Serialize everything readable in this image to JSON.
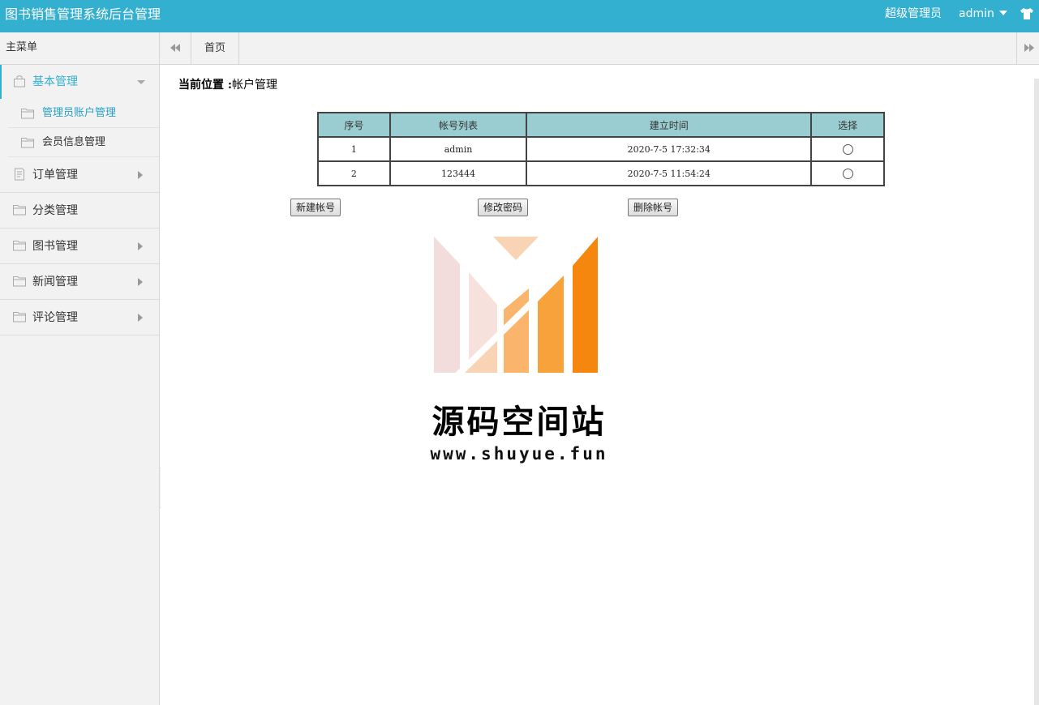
{
  "header": {
    "app_title": "图书销售管理系统后台管理",
    "role": "超级管理员",
    "username": "admin",
    "skin_icon": "tshirt-icon"
  },
  "sidebar": {
    "title": "主菜单",
    "groups": [
      {
        "label": "基本管理",
        "icon": "bag-icon",
        "expanded": true,
        "items": [
          {
            "label": "管理员账户管理",
            "icon": "folder-icon",
            "current": true
          },
          {
            "label": "会员信息管理",
            "icon": "folder-icon",
            "current": false
          }
        ]
      },
      {
        "label": "订单管理",
        "icon": "document-icon"
      },
      {
        "label": "分类管理",
        "icon": "folder-icon"
      },
      {
        "label": "图书管理",
        "icon": "folder-icon"
      },
      {
        "label": "新闻管理",
        "icon": "folder-icon"
      },
      {
        "label": "评论管理",
        "icon": "folder-icon"
      }
    ]
  },
  "tabs": {
    "home": "首页"
  },
  "main": {
    "location_label": "当前位置 :",
    "location_value": "帐户管理",
    "table": {
      "headers": [
        "序号",
        "帐号列表",
        "建立时间",
        "选择"
      ],
      "rows": [
        {
          "no": "1",
          "account": "admin",
          "created": "2020-7-5 17:32:34"
        },
        {
          "no": "2",
          "account": "123444",
          "created": "2020-7-5 11:54:24"
        }
      ]
    },
    "buttons": {
      "create": "新建帐号",
      "change_password": "修改密码",
      "delete": "删除帐号"
    },
    "watermark": {
      "name": "源码空间站",
      "url": "www.shuyue.fun"
    }
  },
  "colors": {
    "accent": "#33afd0",
    "table_header": "#99cdd2",
    "logo_orange": "#f5870f"
  }
}
